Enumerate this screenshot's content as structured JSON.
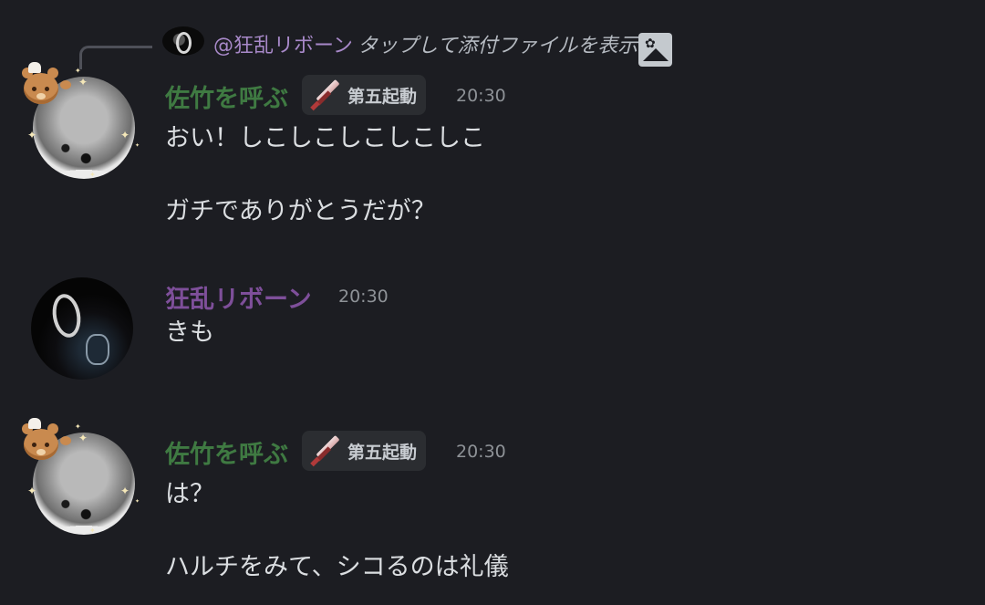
{
  "reply": {
    "mention": "@狂乱リボーン",
    "text": "タップして添付ファイルを表示"
  },
  "messages": [
    {
      "author": "佐竹を呼ぶ",
      "role": "第五起動",
      "time": "20:30",
      "lines": [
        "おい！しこしこしこしこしこ",
        "ガチでありがとうだが？"
      ]
    },
    {
      "author": "狂乱リボーン",
      "time": "20:30",
      "lines": [
        "きも"
      ]
    },
    {
      "author": "佐竹を呼ぶ",
      "role": "第五起動",
      "time": "20:30",
      "lines": [
        "は？",
        "ハルチをみて、シコるのは礼儀"
      ]
    }
  ],
  "colors": {
    "background": "#1c1d22",
    "author_green": "#3f7a42",
    "author_purple": "#7e4f9a",
    "mention": "#a889c9"
  },
  "icons": {
    "role_icon": "sword-icon",
    "attachment_icon": "image-icon"
  }
}
